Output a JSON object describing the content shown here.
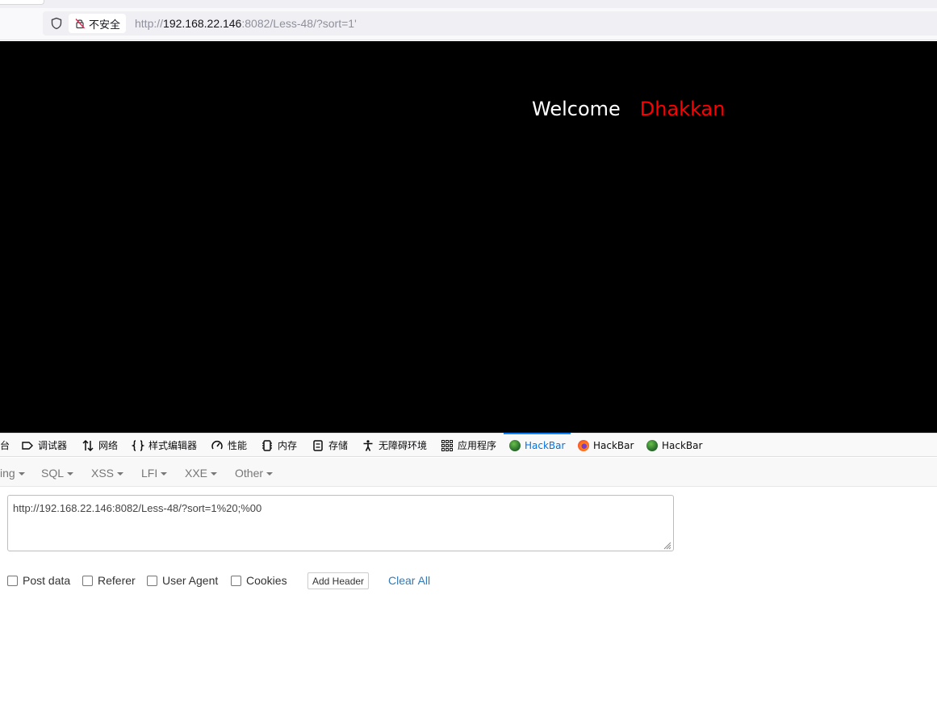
{
  "browser": {
    "security_label": "不安全",
    "url_prefix": "http://",
    "url_host": "192.168.22.146",
    "url_rest": ":8082/Less-48/?sort=1'"
  },
  "page": {
    "welcome": "Welcome",
    "name": "Dhakkan",
    "name_color": "#ff0000"
  },
  "devtools": {
    "tabs": [
      {
        "label": "台",
        "icon": "console-icon"
      },
      {
        "label": "调试器",
        "icon": "debugger-icon"
      },
      {
        "label": "网络",
        "icon": "network-icon"
      },
      {
        "label": "样式编辑器",
        "icon": "style-editor-icon"
      },
      {
        "label": "性能",
        "icon": "performance-icon"
      },
      {
        "label": "内存",
        "icon": "memory-icon"
      },
      {
        "label": "存储",
        "icon": "storage-icon"
      },
      {
        "label": "无障碍环境",
        "icon": "accessibility-icon"
      },
      {
        "label": "应用程序",
        "icon": "application-icon"
      },
      {
        "label": "HackBar",
        "icon": "hackbar-green-icon",
        "active": true
      },
      {
        "label": "HackBar",
        "icon": "hackbar-firefox-icon"
      },
      {
        "label": "HackBar",
        "icon": "hackbar-green-icon"
      }
    ],
    "active_color": "#0074e8"
  },
  "hackbar": {
    "menu": [
      "ing",
      "SQL",
      "XSS",
      "LFI",
      "XXE",
      "Other"
    ],
    "url_value": "http://192.168.22.146:8082/Less-48/?sort=1%20;%00",
    "options": {
      "post_data": "Post data",
      "referer": "Referer",
      "user_agent": "User Agent",
      "cookies": "Cookies"
    },
    "add_header": "Add Header",
    "clear_all": "Clear All",
    "link_color": "#337ab7"
  }
}
